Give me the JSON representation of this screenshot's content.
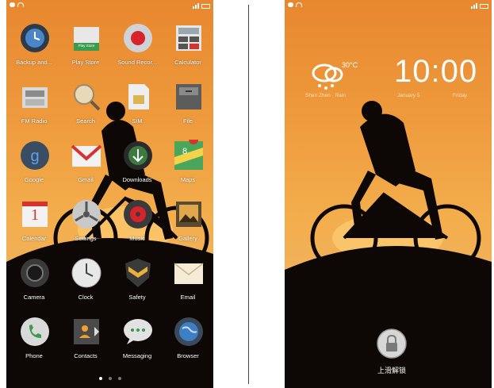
{
  "home_screen": {
    "apps": [
      {
        "label": "Backup and..."
      },
      {
        "label": "Play Store"
      },
      {
        "label": "Sound Recor..."
      },
      {
        "label": "Calculator"
      },
      {
        "label": "FM Radio"
      },
      {
        "label": "Search"
      },
      {
        "label": "SIM"
      },
      {
        "label": "File"
      },
      {
        "label": "Google"
      },
      {
        "label": "Gmail"
      },
      {
        "label": "Downloads"
      },
      {
        "label": "Maps"
      },
      {
        "label": "Calendar"
      },
      {
        "label": "Settings"
      },
      {
        "label": "Music"
      },
      {
        "label": "Gallery"
      },
      {
        "label": "Camera"
      },
      {
        "label": "Clock"
      },
      {
        "label": "Safety"
      },
      {
        "label": "Email"
      },
      {
        "label": "Phone"
      },
      {
        "label": "Contacts"
      },
      {
        "label": "Messaging"
      },
      {
        "label": "Browser"
      }
    ],
    "play_store_badge": "Play Store",
    "calendar_day": "1",
    "page_indicator": {
      "pages": 3,
      "current": 1
    }
  },
  "lock_screen": {
    "temperature": "30°C",
    "time": "10:00",
    "location": "Shen Zhen · Rain",
    "date": "January 5",
    "weekday": "Friday",
    "unlock_label": "上滑解锁"
  },
  "colors": {
    "sky_top": "#e8872f",
    "sky_glow": "#f3ad4c",
    "silhouette": "#0d0805"
  }
}
